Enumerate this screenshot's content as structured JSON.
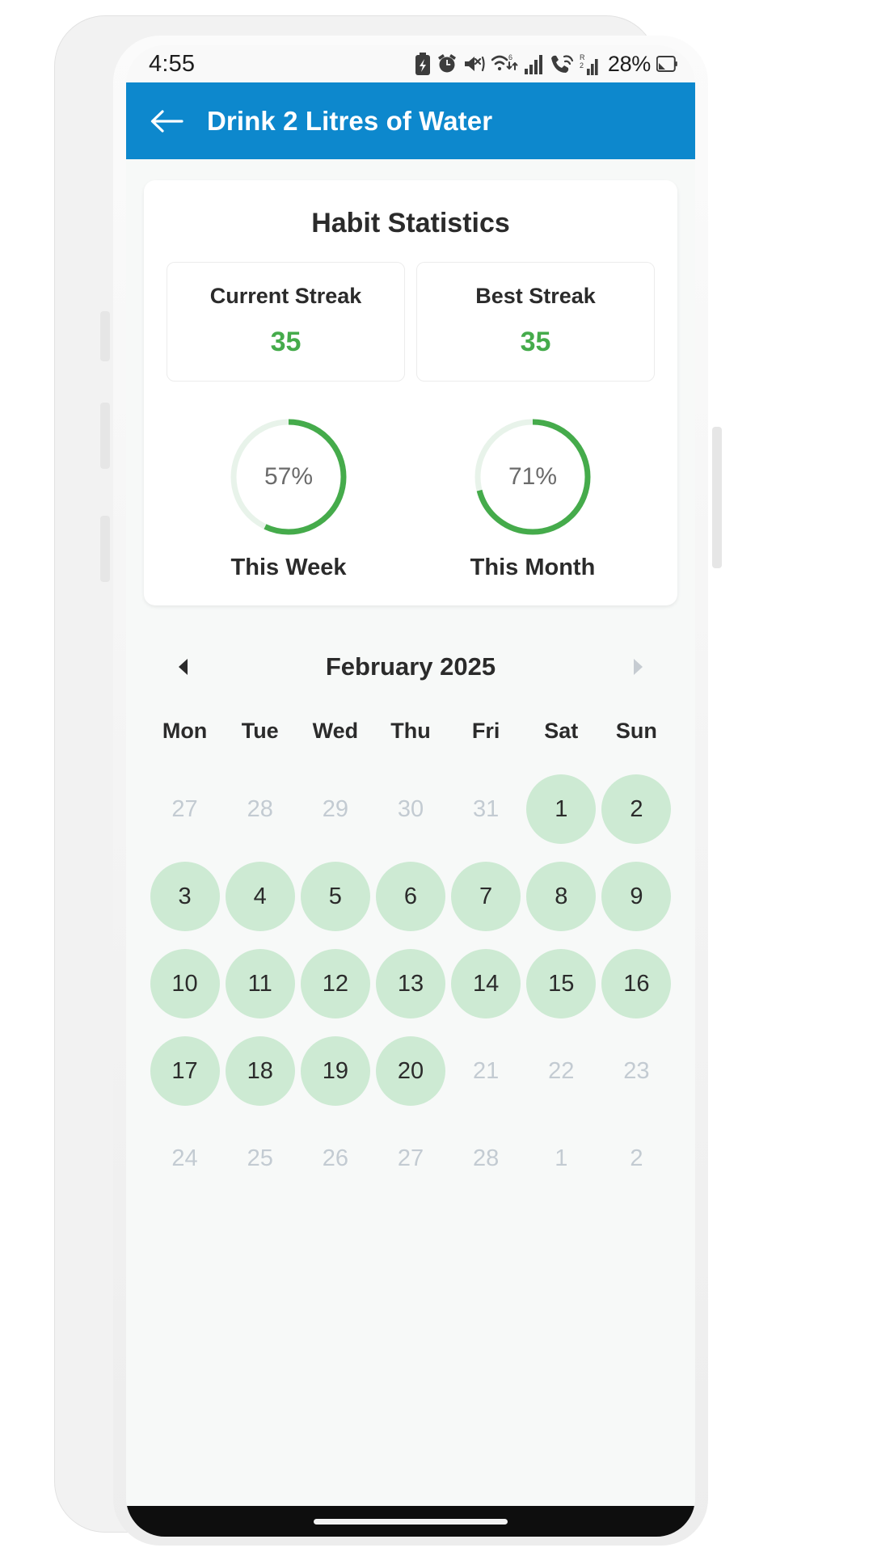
{
  "status_bar": {
    "time": "4:55",
    "battery_percent": "28%",
    "icons": [
      "battery-saver-icon",
      "alarm-icon",
      "vibrate-mute-icon",
      "wifi-transfer-icon",
      "signal-bars-icon",
      "call-forward-icon",
      "signal-bars-2-icon",
      "battery-icon"
    ]
  },
  "app_bar": {
    "back_icon": "arrow-left-icon",
    "title": "Drink 2 Litres of Water",
    "background": "#0d88cd"
  },
  "stats": {
    "title": "Habit Statistics",
    "accent_green": "#45ab4b",
    "streaks": [
      {
        "label": "Current Streak",
        "value": "35"
      },
      {
        "label": "Best Streak",
        "value": "35"
      }
    ],
    "rings": [
      {
        "caption": "This Week",
        "percent_label": "57%",
        "percent": 57
      },
      {
        "caption": "This Month",
        "percent_label": "71%",
        "percent": 71
      }
    ]
  },
  "calendar": {
    "prev_icon": "triangle-left-icon",
    "next_icon": "triangle-right-icon",
    "month_title": "February 2025",
    "weekdays": [
      "Mon",
      "Tue",
      "Wed",
      "Thu",
      "Fri",
      "Sat",
      "Sun"
    ],
    "completed_color": "#cdead3",
    "days": [
      {
        "label": "27",
        "state": "muted"
      },
      {
        "label": "28",
        "state": "muted"
      },
      {
        "label": "29",
        "state": "muted"
      },
      {
        "label": "30",
        "state": "muted"
      },
      {
        "label": "31",
        "state": "muted"
      },
      {
        "label": "1",
        "state": "done"
      },
      {
        "label": "2",
        "state": "done"
      },
      {
        "label": "3",
        "state": "done"
      },
      {
        "label": "4",
        "state": "done"
      },
      {
        "label": "5",
        "state": "done"
      },
      {
        "label": "6",
        "state": "done"
      },
      {
        "label": "7",
        "state": "done"
      },
      {
        "label": "8",
        "state": "done"
      },
      {
        "label": "9",
        "state": "done"
      },
      {
        "label": "10",
        "state": "done"
      },
      {
        "label": "11",
        "state": "done"
      },
      {
        "label": "12",
        "state": "done"
      },
      {
        "label": "13",
        "state": "done"
      },
      {
        "label": "14",
        "state": "done"
      },
      {
        "label": "15",
        "state": "done"
      },
      {
        "label": "16",
        "state": "done"
      },
      {
        "label": "17",
        "state": "done"
      },
      {
        "label": "18",
        "state": "done"
      },
      {
        "label": "19",
        "state": "done"
      },
      {
        "label": "20",
        "state": "done"
      },
      {
        "label": "21",
        "state": "muted"
      },
      {
        "label": "22",
        "state": "muted"
      },
      {
        "label": "23",
        "state": "muted"
      },
      {
        "label": "24",
        "state": "muted"
      },
      {
        "label": "25",
        "state": "muted"
      },
      {
        "label": "26",
        "state": "muted"
      },
      {
        "label": "27",
        "state": "muted"
      },
      {
        "label": "28",
        "state": "muted"
      },
      {
        "label": "1",
        "state": "muted"
      },
      {
        "label": "2",
        "state": "muted"
      }
    ]
  }
}
